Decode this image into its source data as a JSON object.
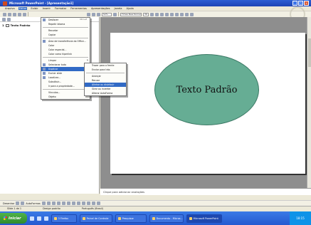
{
  "window": {
    "title": "Microsoft PowerPoint - [Apresentação1]"
  },
  "menubar": {
    "items": [
      "Arquivo",
      "Editar",
      "Exibir",
      "Inserir",
      "Formatar",
      "Ferramentas",
      "Apresentações",
      "Janela",
      "Ajuda"
    ],
    "active_index": 1
  },
  "toolbar": {
    "zoom": "52%",
    "font_name": "Times New Roman",
    "font_size": "36"
  },
  "outline": {
    "items": [
      {
        "number": "1",
        "text": "Texto Padrão"
      }
    ]
  },
  "slide": {
    "shape_text": "Texto Padrão"
  },
  "notes": {
    "placeholder": "Clique para adicionar anotações"
  },
  "edit_menu": {
    "items": [
      {
        "label": "Desfazer",
        "shortcut": "Ctrl+Z"
      },
      {
        "label": "Repetir Idioma"
      },
      {
        "label": "Recortar"
      },
      {
        "label": "Copiar"
      },
      {
        "label": "Área de transferência do Office..."
      },
      {
        "label": "Colar"
      },
      {
        "label": "Colar especial..."
      },
      {
        "label": "Colar como hiperlink"
      },
      {
        "label": "Limpar"
      },
      {
        "label": "Selecionar tudo"
      },
      {
        "label": "Duplicar"
      },
      {
        "label": "Excluir slide"
      },
      {
        "label": "Localizar..."
      },
      {
        "label": "Substituir..."
      },
      {
        "label": "Ir para a propriedade..."
      },
      {
        "label": "Vínculos..."
      },
      {
        "label": "Objeto"
      }
    ]
  },
  "context_menu": {
    "items": [
      {
        "label": "Recortar"
      },
      {
        "label": "Copiar"
      },
      {
        "label": "Colar"
      },
      {
        "label": "Editar texto"
      },
      {
        "label": "Agrupamento"
      },
      {
        "label": "Ordem"
      },
      {
        "label": "Configurar ação..."
      },
      {
        "label": "Formatar AutoForma..."
      },
      {
        "label": "Hiperlink..."
      }
    ]
  },
  "submenu": {
    "items": [
      {
        "label": "Trazer para a frente"
      },
      {
        "label": "Enviar para trás"
      },
      {
        "label": "Avançar"
      },
      {
        "label": "Recuar"
      },
      {
        "label": "Alinhar ou distribuir"
      },
      {
        "label": "Girar ou inverter"
      },
      {
        "label": "Alterar AutoForma"
      }
    ],
    "selected_index": 4
  },
  "drawbar": {
    "draw_label": "Desenhar",
    "autoshapes_label": "AutoFormas"
  },
  "statusbar": {
    "slide": "Slide 1 de 1",
    "design": "Design padrão",
    "language": "Português (Brasil)"
  },
  "taskbar": {
    "start": "Iniciar",
    "items": [
      {
        "label": "3 Firefox"
      },
      {
        "label": "Painel de Controle"
      },
      {
        "label": "Pesquisar"
      },
      {
        "label": "Documento - Micros..."
      },
      {
        "label": "Microsoft PowerPoint"
      }
    ],
    "active_index": 4,
    "clock": "18:15"
  },
  "colors": {
    "ellipse_fill": "#66ad94",
    "menu_highlight": "#316ac5",
    "taskbar": "#2459d0"
  }
}
